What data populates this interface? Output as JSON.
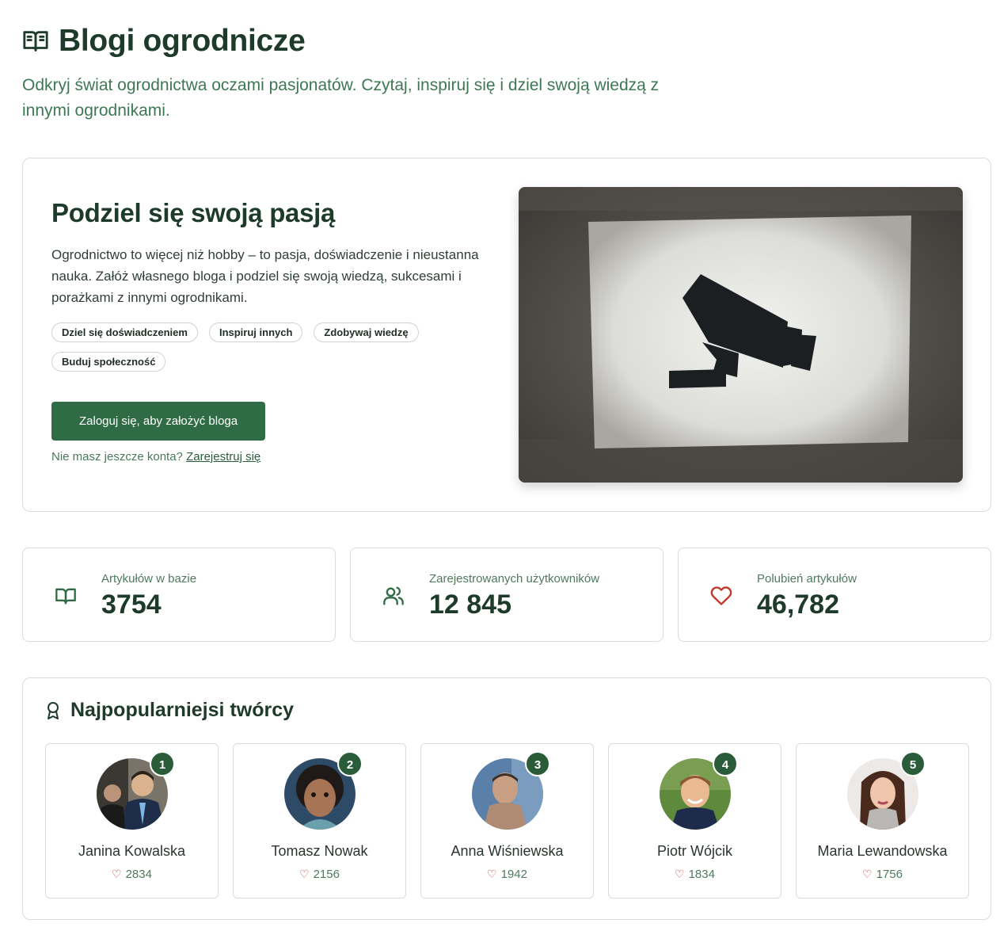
{
  "header": {
    "title": "Blogi ogrodnicze",
    "subtitle": "Odkryj świat ogrodnictwa oczami pasjonatów. Czytaj, inspiruj się i dziel swoją wiedzą z innymi ogrodnikami."
  },
  "hero": {
    "title": "Podziel się swoją pasją",
    "description": "Ogrodnictwo to więcej niż hobby – to pasja, doświadczenie i nieustanna nauka. Załóż własnego bloga i podziel się swoją wiedzą, sukcesami i porażkami z innymi ogrodnikami.",
    "tags": [
      "Dziel się doświadczeniem",
      "Inspiruj innych",
      "Zdobywaj wiedzę",
      "Buduj społeczność"
    ],
    "login_button": "Zaloguj się, aby założyć bloga",
    "register_prompt": "Nie masz jeszcze konta?",
    "register_link": "Zarejestruj się",
    "image_icon": "security-camera-stencil-photo"
  },
  "stats": [
    {
      "icon": "book-icon",
      "label": "Artykułów w bazie",
      "value": "3754"
    },
    {
      "icon": "users-icon",
      "label": "Zarejestrowanych użytkowników",
      "value": "12 845"
    },
    {
      "icon": "heart-icon",
      "label": "Polubień artykułów",
      "value": "46,782"
    }
  ],
  "creators": {
    "title": "Najpopularniejsi twórcy",
    "items": [
      {
        "rank": "1",
        "name": "Janina Kowalska",
        "likes": "2834"
      },
      {
        "rank": "2",
        "name": "Tomasz Nowak",
        "likes": "2156"
      },
      {
        "rank": "3",
        "name": "Anna Wiśniewska",
        "likes": "1942"
      },
      {
        "rank": "4",
        "name": "Piotr Wójcik",
        "likes": "1834"
      },
      {
        "rank": "5",
        "name": "Maria Lewandowska",
        "likes": "1756"
      }
    ]
  },
  "colors": {
    "accent": "#2f6b44",
    "heading": "#1e3a2a",
    "subtitle": "#3e7754",
    "heart": "#c0392b"
  }
}
